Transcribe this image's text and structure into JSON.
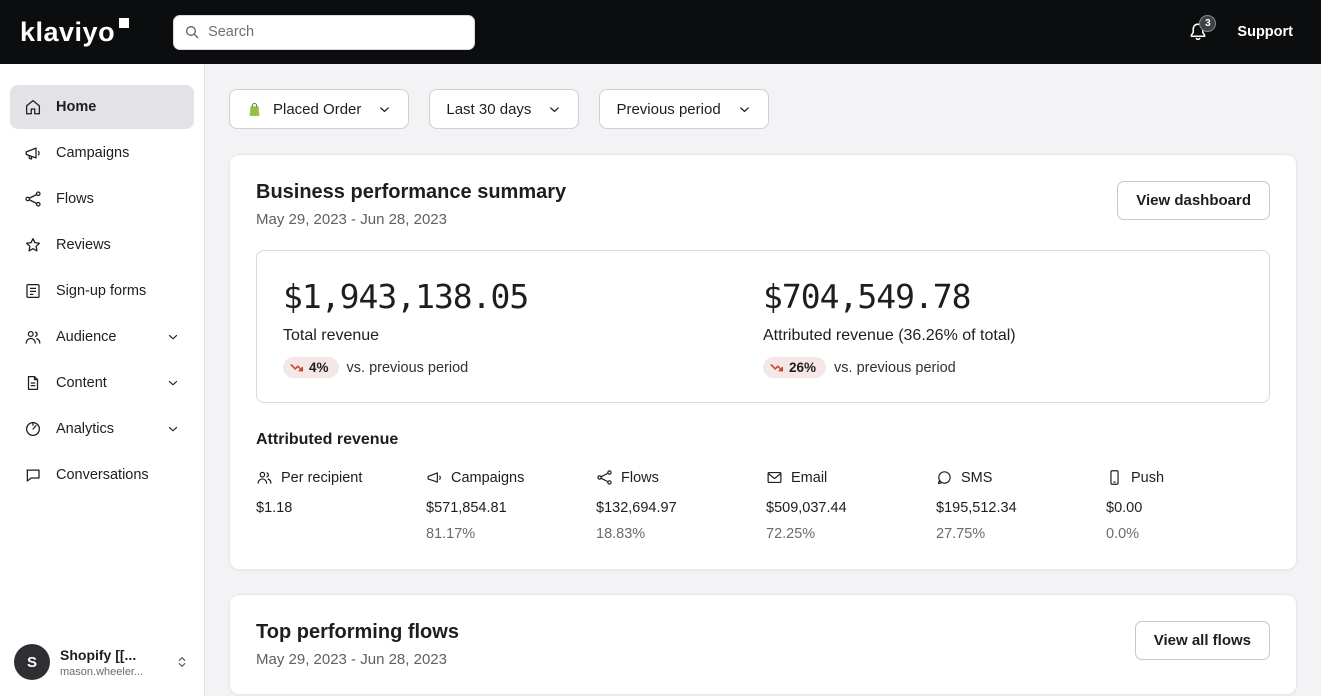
{
  "header": {
    "logo": "klaviyo",
    "search_placeholder": "Search",
    "notification_count": "3",
    "support_label": "Support"
  },
  "sidebar": {
    "items": [
      {
        "label": "Home",
        "icon": "home-icon",
        "active": true
      },
      {
        "label": "Campaigns",
        "icon": "megaphone-icon"
      },
      {
        "label": "Flows",
        "icon": "flows-icon"
      },
      {
        "label": "Reviews",
        "icon": "star-icon"
      },
      {
        "label": "Sign-up forms",
        "icon": "form-icon"
      },
      {
        "label": "Audience",
        "icon": "people-icon",
        "expandable": true
      },
      {
        "label": "Content",
        "icon": "file-icon",
        "expandable": true
      },
      {
        "label": "Analytics",
        "icon": "gauge-icon",
        "expandable": true
      },
      {
        "label": "Conversations",
        "icon": "chat-icon"
      }
    ],
    "profile": {
      "initial": "S",
      "name": "Shopify [[...",
      "email": "mason.wheeler..."
    }
  },
  "filters": {
    "metric": "Placed Order",
    "date_range": "Last 30 days",
    "comparison": "Previous period"
  },
  "performance_card": {
    "title": "Business performance summary",
    "date_range": "May 29, 2023 - Jun 28, 2023",
    "button_label": "View dashboard",
    "total_revenue": {
      "value": "$1,943,138.05",
      "label": "Total revenue",
      "change": "4%",
      "change_direction": "down",
      "change_note": "vs. previous period"
    },
    "attributed_revenue": {
      "value": "$704,549.78",
      "label": "Attributed revenue (36.26% of total)",
      "change": "26%",
      "change_direction": "down",
      "change_note": "vs. previous period"
    },
    "breakdown_title": "Attributed revenue",
    "breakdown": [
      {
        "label": "Per recipient",
        "icon": "people-icon",
        "value": "$1.18",
        "percent": ""
      },
      {
        "label": "Campaigns",
        "icon": "megaphone-icon",
        "value": "$571,854.81",
        "percent": "81.17%"
      },
      {
        "label": "Flows",
        "icon": "flows-icon",
        "value": "$132,694.97",
        "percent": "18.83%"
      },
      {
        "label": "Email",
        "icon": "envelope-icon",
        "value": "$509,037.44",
        "percent": "72.25%"
      },
      {
        "label": "SMS",
        "icon": "speech-bubble-icon",
        "value": "$195,512.34",
        "percent": "27.75%"
      },
      {
        "label": "Push",
        "icon": "mobile-icon",
        "value": "$0.00",
        "percent": "0.0%"
      }
    ],
    "colors": {
      "negative_arrow": "#c2412f",
      "negative_pill_bg": "#f6e7e7",
      "shopify_green": "#95bf47"
    }
  },
  "flows_card": {
    "title": "Top performing flows",
    "date_range": "May 29, 2023 - Jun 28, 2023",
    "button_label": "View all flows"
  }
}
